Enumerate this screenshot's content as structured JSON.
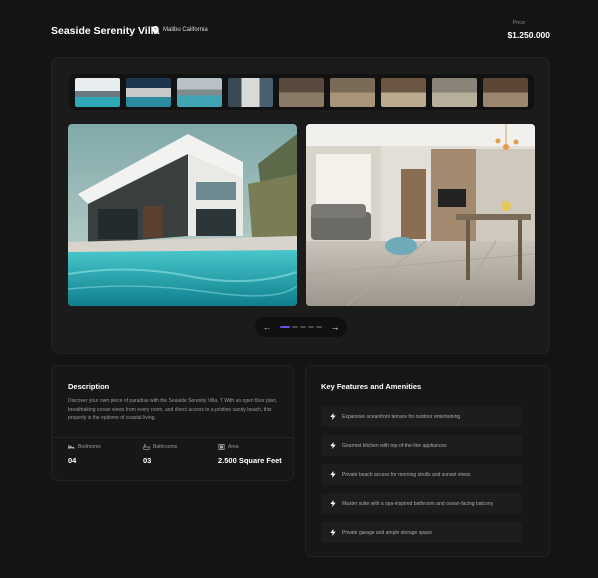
{
  "header": {
    "title": "Seaside Serenity Villa",
    "location": "Malibu California",
    "price_label": "Price",
    "price": "$1.250.000"
  },
  "gallery": {
    "thumbnails": [
      "thumb-1",
      "thumb-2",
      "thumb-3",
      "thumb-4",
      "thumb-5",
      "thumb-6",
      "thumb-7",
      "thumb-8",
      "thumb-9"
    ],
    "active_page": 1,
    "page_count": 5
  },
  "description": {
    "heading": "Description",
    "text": "Discover your own piece of paradise with the Seaside Serenity Villa. T With an open floor plan, breathtaking ocean views from every room, and direct access to a pristine sandy beach, this property is the epitome of coastal living.",
    "specs": [
      {
        "icon": "bed-icon",
        "label": "Bedrooms",
        "value": "04"
      },
      {
        "icon": "bath-icon",
        "label": "Bathrooms",
        "value": "03"
      },
      {
        "icon": "area-icon",
        "label": "Area",
        "value": "2.500 Square Feet"
      }
    ]
  },
  "features": {
    "heading": "Key Features and Amenities",
    "items": [
      "Expansive oceanfront terrace for outdoor entertaining",
      "Gourmet kitchen with top-of-the-line appliances",
      "Private beach access for morning strolls and sunset views",
      "Master suite with a spa-inspired bathroom and ocean-facing balcony",
      "Private garage and ample storage space"
    ]
  }
}
